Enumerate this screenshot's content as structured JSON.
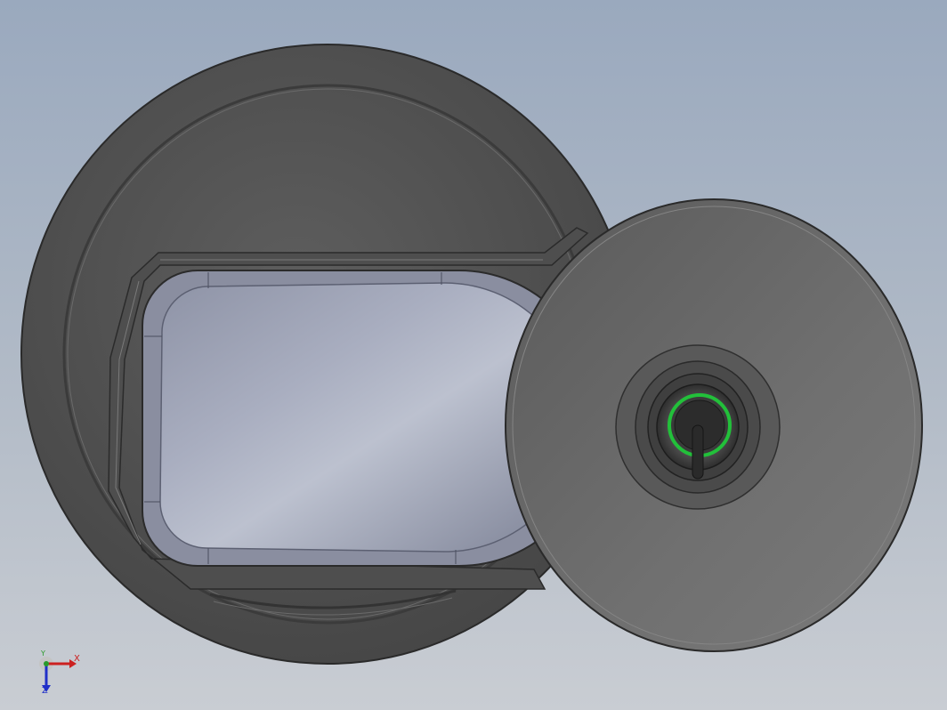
{
  "viewport": {
    "background_top": "#9aa9be",
    "background_bottom": "#c9cdd3"
  },
  "model": {
    "body_color": "#545454",
    "lid_color": "#6b6b6b",
    "window_color": "#a4a9ba",
    "indicator_ring_color": "#22c03a"
  },
  "triad": {
    "x_label": "X",
    "y_label": "Y",
    "z_label": "Z",
    "x_color": "#cc2020",
    "y_color": "#2a9a2a",
    "z_color": "#2030c8"
  }
}
